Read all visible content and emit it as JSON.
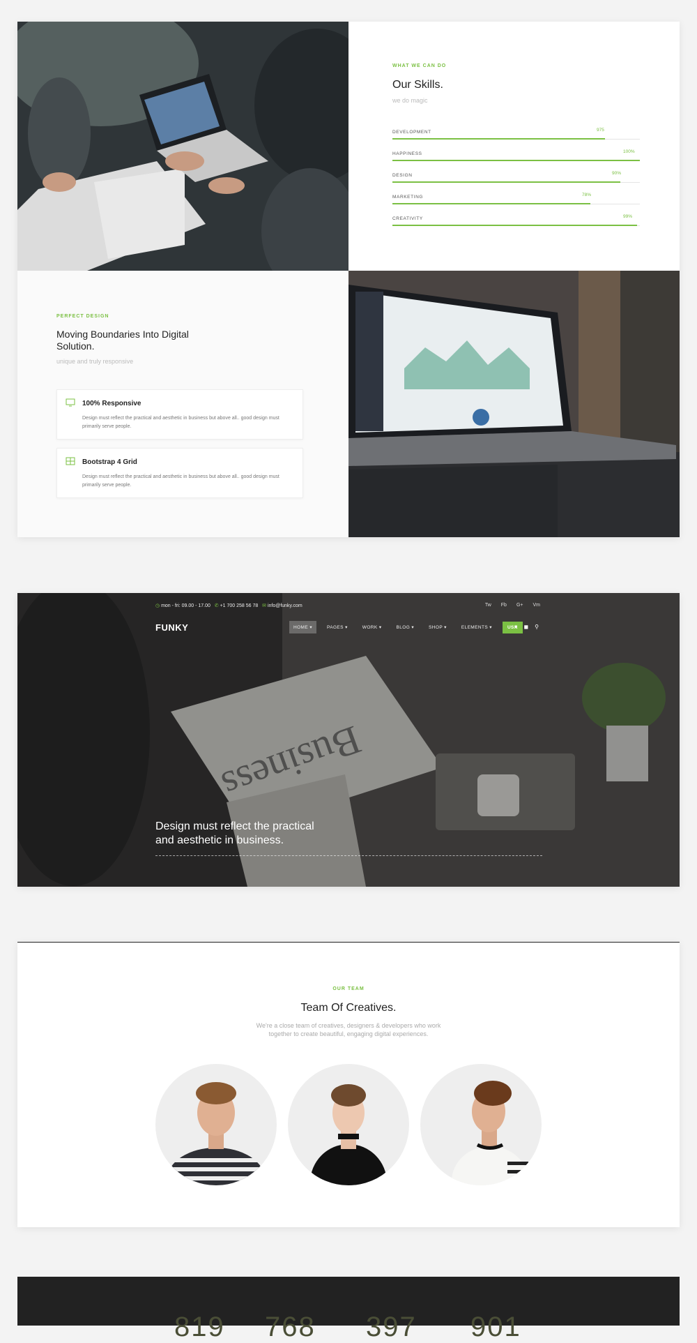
{
  "skills": {
    "eyebrow": "WHAT WE CAN DO",
    "title": "Our Skills.",
    "subtitle": "we do magic",
    "items": [
      {
        "label": "DEVELOPMENT",
        "percent_label": "975",
        "value": 0.86
      },
      {
        "label": "HAPPINESS",
        "percent_label": "100%",
        "value": 1.0
      },
      {
        "label": "DESIGN",
        "percent_label": "90%",
        "value": 0.92
      },
      {
        "label": "MARKETING",
        "percent_label": "78%",
        "value": 0.8
      },
      {
        "label": "CREATIVITY",
        "percent_label": "99%",
        "value": 0.99
      }
    ]
  },
  "design": {
    "eyebrow": "PERFECT DESIGN",
    "title": "Moving Boundaries Into Digital Solution.",
    "subtitle": "unique and truly responsive",
    "features": [
      {
        "icon": "monitor-icon",
        "title": "100% Responsive",
        "desc": "Design must reflect the practical and aesthetic in business but above all.. good design must primarily serve people."
      },
      {
        "icon": "grid-icon",
        "title": "Bootstrap 4 Grid",
        "desc": "Design must reflect the practical and aesthetic in business but above all.. good design must primarily serve people."
      }
    ]
  },
  "hero": {
    "hours": "mon - fri: 09.00 - 17.00",
    "phone": "+1 700 258 56 78",
    "email": "info@funky.com",
    "social": [
      "Tw",
      "Fb",
      "G+",
      "Vm"
    ],
    "brand": "FUNKY",
    "menu": [
      "HOME",
      "PAGES",
      "WORK",
      "BLOG",
      "SHOP",
      "ELEMENTS"
    ],
    "lang": "USA",
    "headline_1": "Design must reflect the practical",
    "headline_2": "and aesthetic in business.",
    "newspaper": "Business"
  },
  "team": {
    "eyebrow": "OUR TEAM",
    "title": "Team Of Creatives.",
    "desc_1": "We're a close team of creatives, designers & developers who work",
    "desc_2": "together to create beautiful, engaging digital experiences."
  },
  "stats": [
    "819",
    "768",
    "397",
    "901"
  ],
  "colors": {
    "accent": "#7bc043",
    "dark": "#222222"
  }
}
